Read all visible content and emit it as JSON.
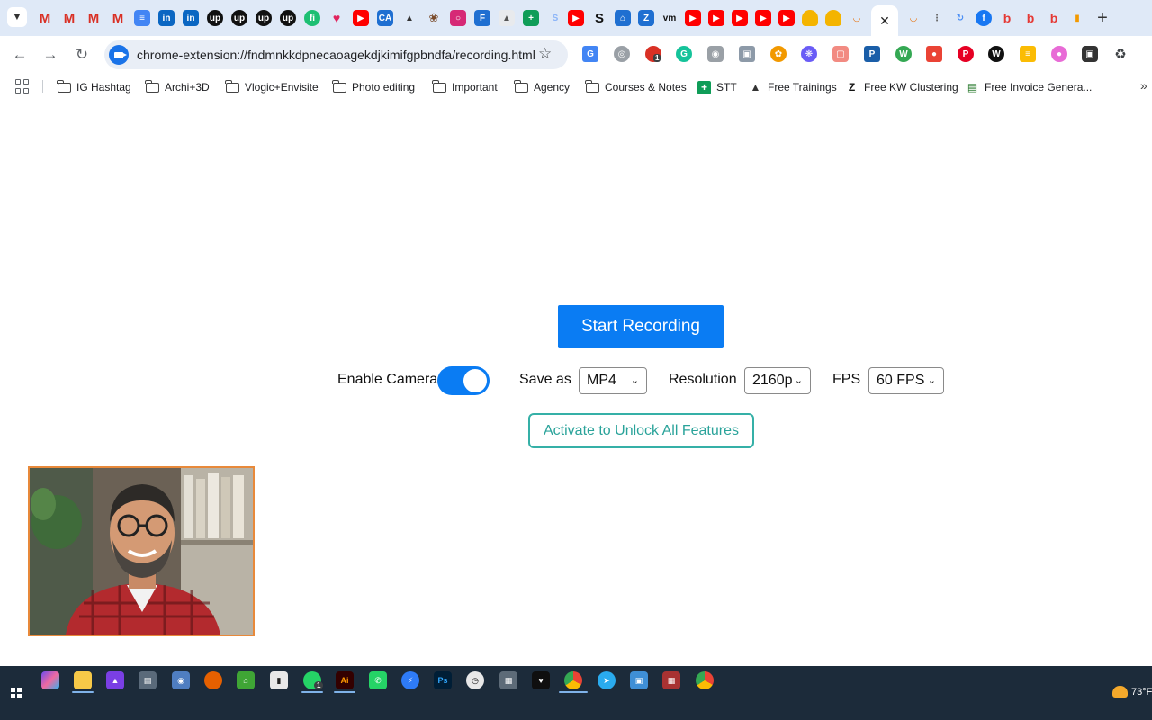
{
  "browser": {
    "address_bar": {
      "url": "chrome-extension://fndmnkkdpnecaoagekdjkimifgpbndfa/recording.html"
    },
    "bookmarks": [
      {
        "label": "IG Hashtag",
        "icon": "folder-icon"
      },
      {
        "label": "Archi+3D",
        "icon": "folder-icon"
      },
      {
        "label": "Vlogic+Envisite",
        "icon": "folder-icon"
      },
      {
        "label": "Photo editing",
        "icon": "folder-icon"
      },
      {
        "label": "Important",
        "icon": "folder-icon"
      },
      {
        "label": "Agency",
        "icon": "folder-icon"
      },
      {
        "label": "Courses & Notes",
        "icon": "folder-icon"
      },
      {
        "label": "STT",
        "icon": "sheets-icon"
      },
      {
        "label": "Free Trainings",
        "icon": "mountain-icon"
      },
      {
        "label": "Free KW Clustering",
        "icon": "z-icon"
      },
      {
        "label": "Free Invoice Genera...",
        "icon": "invoice-icon"
      }
    ],
    "extension_badge": "1"
  },
  "recorder": {
    "start_label": "Start Recording",
    "camera_label": "Enable Camera",
    "camera_enabled": true,
    "save_as_label": "Save as",
    "save_as_value": "MP4",
    "resolution_label": "Resolution",
    "resolution_value": "2160p",
    "fps_label": "FPS",
    "fps_value": "60 FPS",
    "activate_label": "Activate to Unlock All Features"
  },
  "taskbar": {
    "temperature": "73°F",
    "whatsapp_badge": "1"
  },
  "colors": {
    "primary": "#0a7cf3",
    "teal": "#35b0a7",
    "camera_border": "#e8893a",
    "taskbar": "#1c2b3a"
  }
}
